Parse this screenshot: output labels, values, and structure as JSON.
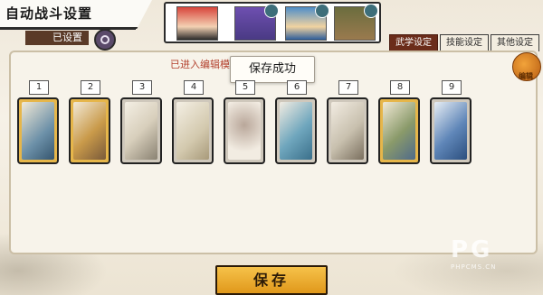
{
  "header": {
    "title": "自动战斗设置"
  },
  "preset": {
    "label": "已设置"
  },
  "tabs": [
    {
      "label": "武学设定",
      "active": true
    },
    {
      "label": "技能设定",
      "active": false
    },
    {
      "label": "其他设定",
      "active": false
    }
  ],
  "hint": "已进入编辑模                 卡牌的优先级",
  "toast": "保存成功",
  "edit": {
    "label": "编辑"
  },
  "slots": [
    "1",
    "2",
    "3",
    "4",
    "5",
    "6",
    "7",
    "8",
    "9"
  ],
  "cards": [
    {
      "name": "card-1",
      "color": "#6c90a8"
    },
    {
      "name": "card-2",
      "color": "#7a5a3a"
    },
    {
      "name": "card-3",
      "color": "#d8cfbc"
    },
    {
      "name": "card-4",
      "color": "#d3c9ae"
    },
    {
      "name": "card-5",
      "color": "#b9a79a"
    },
    {
      "name": "card-6",
      "color": "#6fa6bd"
    },
    {
      "name": "card-7",
      "color": "#c8c0ae"
    },
    {
      "name": "card-8",
      "color": "#8a9a6a"
    },
    {
      "name": "card-9",
      "color": "#5f86b8"
    }
  ],
  "save_button": "保存",
  "watermark": {
    "logo": "PG",
    "text": "PHPCMS.CN"
  },
  "colors": {
    "accent": "#6b2c1a",
    "button": "#f0b033",
    "hint": "#b3412e"
  }
}
